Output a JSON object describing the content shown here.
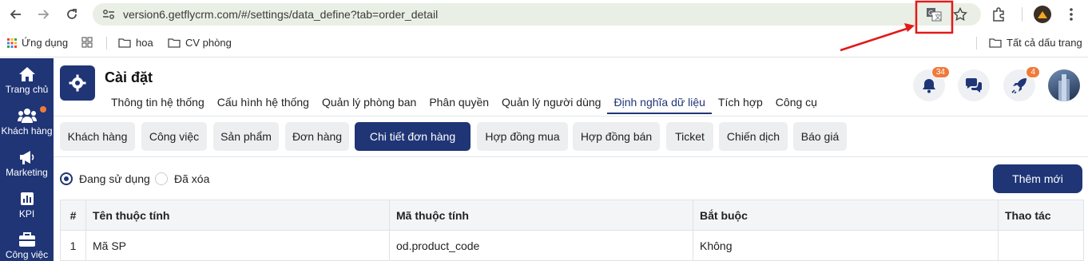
{
  "browser": {
    "url": "version6.getflycrm.com/#/settings/data_define?tab=order_detail",
    "bookmarks": [
      "Ứng dụng",
      "hoa",
      "CV phòng"
    ],
    "all_bookmarks": "Tất cả dấu trang"
  },
  "sidebar": {
    "items": [
      {
        "label": "Trang chủ",
        "icon": "home-icon"
      },
      {
        "label": "Khách hàng",
        "icon": "users-icon"
      },
      {
        "label": "Marketing",
        "icon": "megaphone-icon"
      },
      {
        "label": "KPI",
        "icon": "chart-icon"
      },
      {
        "label": "Công việc",
        "icon": "briefcase-icon"
      }
    ]
  },
  "header": {
    "title": "Cài đặt",
    "tabs": [
      "Thông tin hệ thống",
      "Cấu hình hệ thống",
      "Quản lý phòng ban",
      "Phân quyền",
      "Quản lý người dùng",
      "Định nghĩa dữ liệu",
      "Tích hợp",
      "Công cụ"
    ],
    "active_tab": "Định nghĩa dữ liệu",
    "notif_count": "34",
    "rocket_count": "4"
  },
  "type_tabs": [
    "Khách hàng",
    "Công việc",
    "Sản phẩm",
    "Đơn hàng",
    "Chi tiết đơn hàng",
    "Hợp đồng mua",
    "Hợp đồng bán",
    "Ticket",
    "Chiến dịch",
    "Báo giá"
  ],
  "active_type_tab": "Chi tiết đơn hàng",
  "filter": {
    "in_use": "Đang sử dụng",
    "deleted": "Đã xóa",
    "add_button": "Thêm mới"
  },
  "table": {
    "headers": [
      "#",
      "Tên thuộc tính",
      "Mã thuộc tính",
      "Bắt buộc",
      "Thao tác"
    ],
    "rows": [
      [
        "1",
        "Mã SP",
        "od.product_code",
        "Không",
        ""
      ]
    ]
  },
  "colors": {
    "brand": "#1f3576",
    "badge": "#f07a3a",
    "annotation": "#e21a1a"
  }
}
